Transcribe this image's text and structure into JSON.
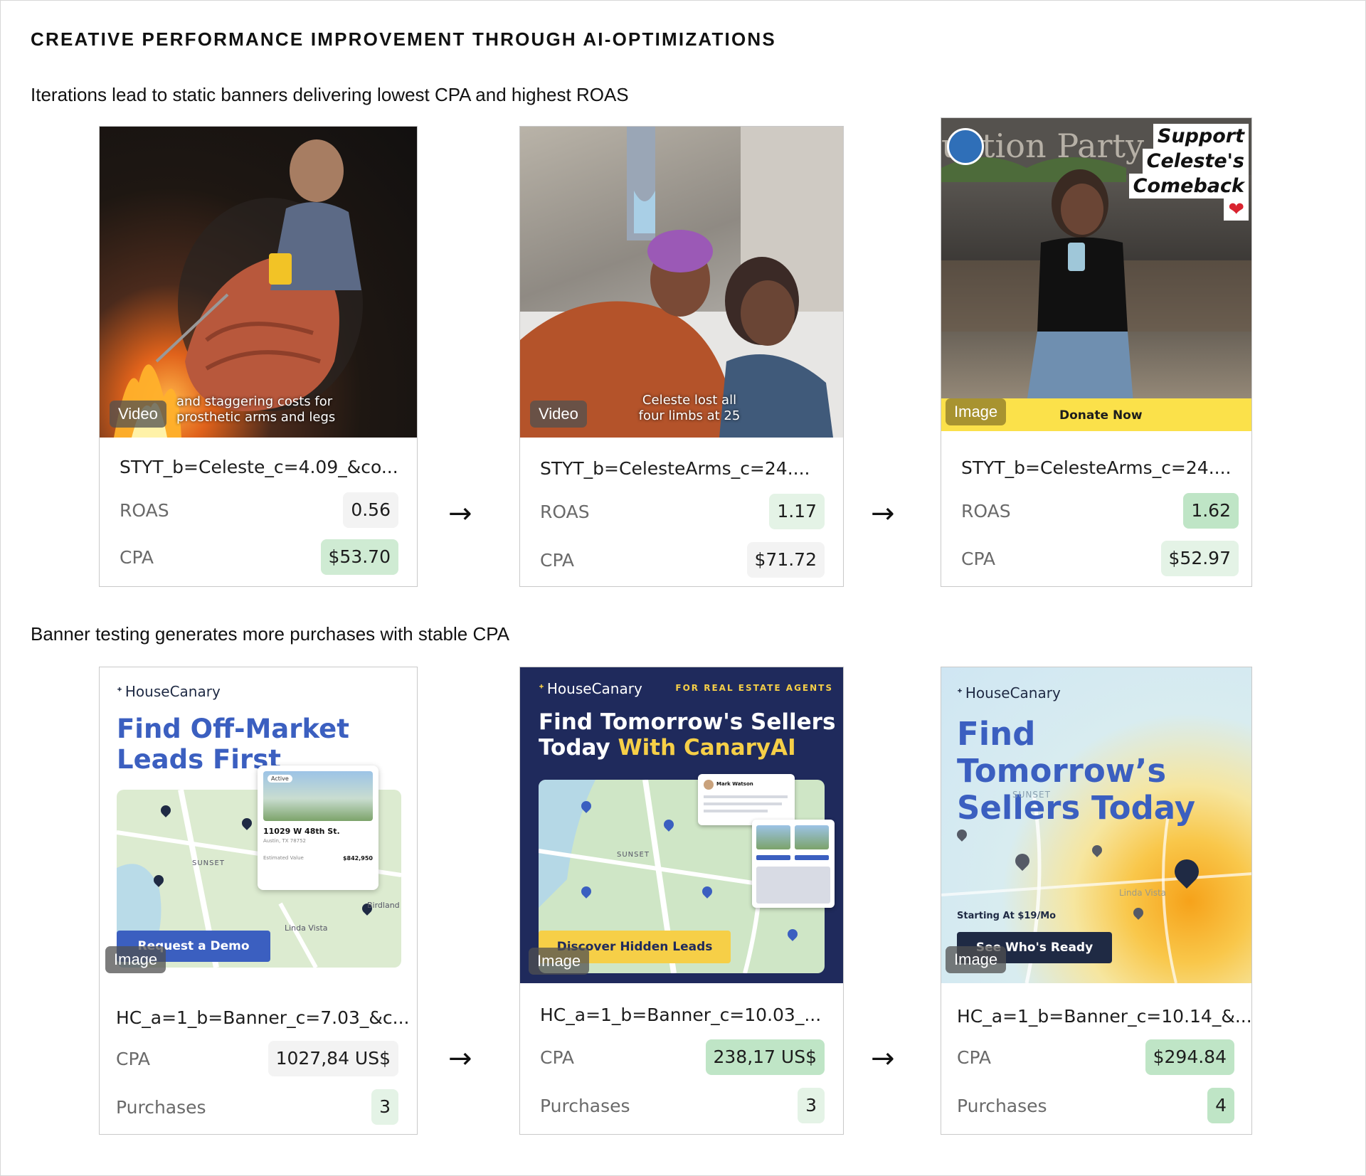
{
  "header": {
    "title": "CREATIVE PERFORMANCE IMPROVEMENT THROUGH AI-OPTIMIZATIONS",
    "section1": "Iterations lead to static banners delivering lowest CPA and highest ROAS",
    "section2": "Banner testing generates more purchases with stable CPA"
  },
  "arrow_glyph": "→",
  "row1": [
    {
      "media_type": "Video",
      "caption": [
        "and staggering costs for",
        "prosthetic arms and legs"
      ],
      "name": "STYT_b=Celeste_c=4.09_&co...",
      "metrics": [
        {
          "label": "ROAS",
          "value": "0.56",
          "highlight": "neutral"
        },
        {
          "label": "CPA",
          "value": "$53.70",
          "highlight": "mid"
        }
      ]
    },
    {
      "media_type": "Video",
      "caption": [
        "Celeste lost all",
        "four limbs at 25"
      ],
      "name": "STYT_b=CelesteArms_c=24....",
      "metrics": [
        {
          "label": "ROAS",
          "value": "1.17",
          "highlight": "light"
        },
        {
          "label": "CPA",
          "value": "$71.72",
          "highlight": "neutral"
        }
      ]
    },
    {
      "media_type": "Image",
      "overlay_lines": [
        "Support",
        "Celeste's",
        "Comeback"
      ],
      "heart": "❤",
      "background_sign": "uation Party",
      "cta": "Donate Now",
      "name": "STYT_b=CelesteArms_c=24....",
      "metrics": [
        {
          "label": "ROAS",
          "value": "1.62",
          "highlight": "strong"
        },
        {
          "label": "CPA",
          "value": "$52.97",
          "highlight": "light"
        }
      ]
    }
  ],
  "row2": [
    {
      "media_type": "Image",
      "brand": "HouseCanary",
      "headline": [
        "Find Off-Market",
        "Leads First"
      ],
      "listing": {
        "status": "Active",
        "address": "11029 W 48th St.",
        "city": "Austin, TX 78752",
        "label": "Estimated Value",
        "value": "$842,950"
      },
      "map_labels": [
        "SUNSET",
        "Birdland",
        "Linda Vista"
      ],
      "cta": "Request a Demo",
      "name": "HC_a=1_b=Banner_c=7.03_&c...",
      "metrics": [
        {
          "label": "CPA",
          "value": "1027,84 US$",
          "highlight": "neutral"
        },
        {
          "label": "Purchases",
          "value": "3",
          "highlight": "light"
        }
      ]
    },
    {
      "media_type": "Image",
      "brand": "HouseCanary",
      "tagline": "FOR REAL ESTATE AGENTS",
      "headline": [
        "Find Tomorrow's Sellers",
        "Today "
      ],
      "headline_accent": "With CanaryAI",
      "chat_name": "Mark Watson",
      "map_labels": [
        "SUNSET"
      ],
      "cta": "Discover Hidden Leads",
      "name": "HC_a=1_b=Banner_c=10.03_...",
      "metrics": [
        {
          "label": "CPA",
          "value": "238,17 US$",
          "highlight": "strong"
        },
        {
          "label": "Purchases",
          "value": "3",
          "highlight": "light"
        }
      ]
    },
    {
      "media_type": "Image",
      "brand": "HouseCanary",
      "headline": [
        "Find Tomorrow’s",
        "Sellers Today"
      ],
      "price_note": "Starting At $19/Mo",
      "map_labels": [
        "SUNSET",
        "Linda Vista"
      ],
      "cta": "See Who's Ready",
      "name": "HC_a=1_b=Banner_c=10.14_&...",
      "metrics": [
        {
          "label": "CPA",
          "value": "$294.84",
          "highlight": "strong"
        },
        {
          "label": "Purchases",
          "value": "4",
          "highlight": "strong"
        }
      ]
    }
  ],
  "colors": {
    "hc_blue": "#3b5fc0",
    "hc_navy": "#1f2a5c",
    "hc_yellow": "#f6cf47",
    "donate_yellow": "#fbe14a"
  }
}
